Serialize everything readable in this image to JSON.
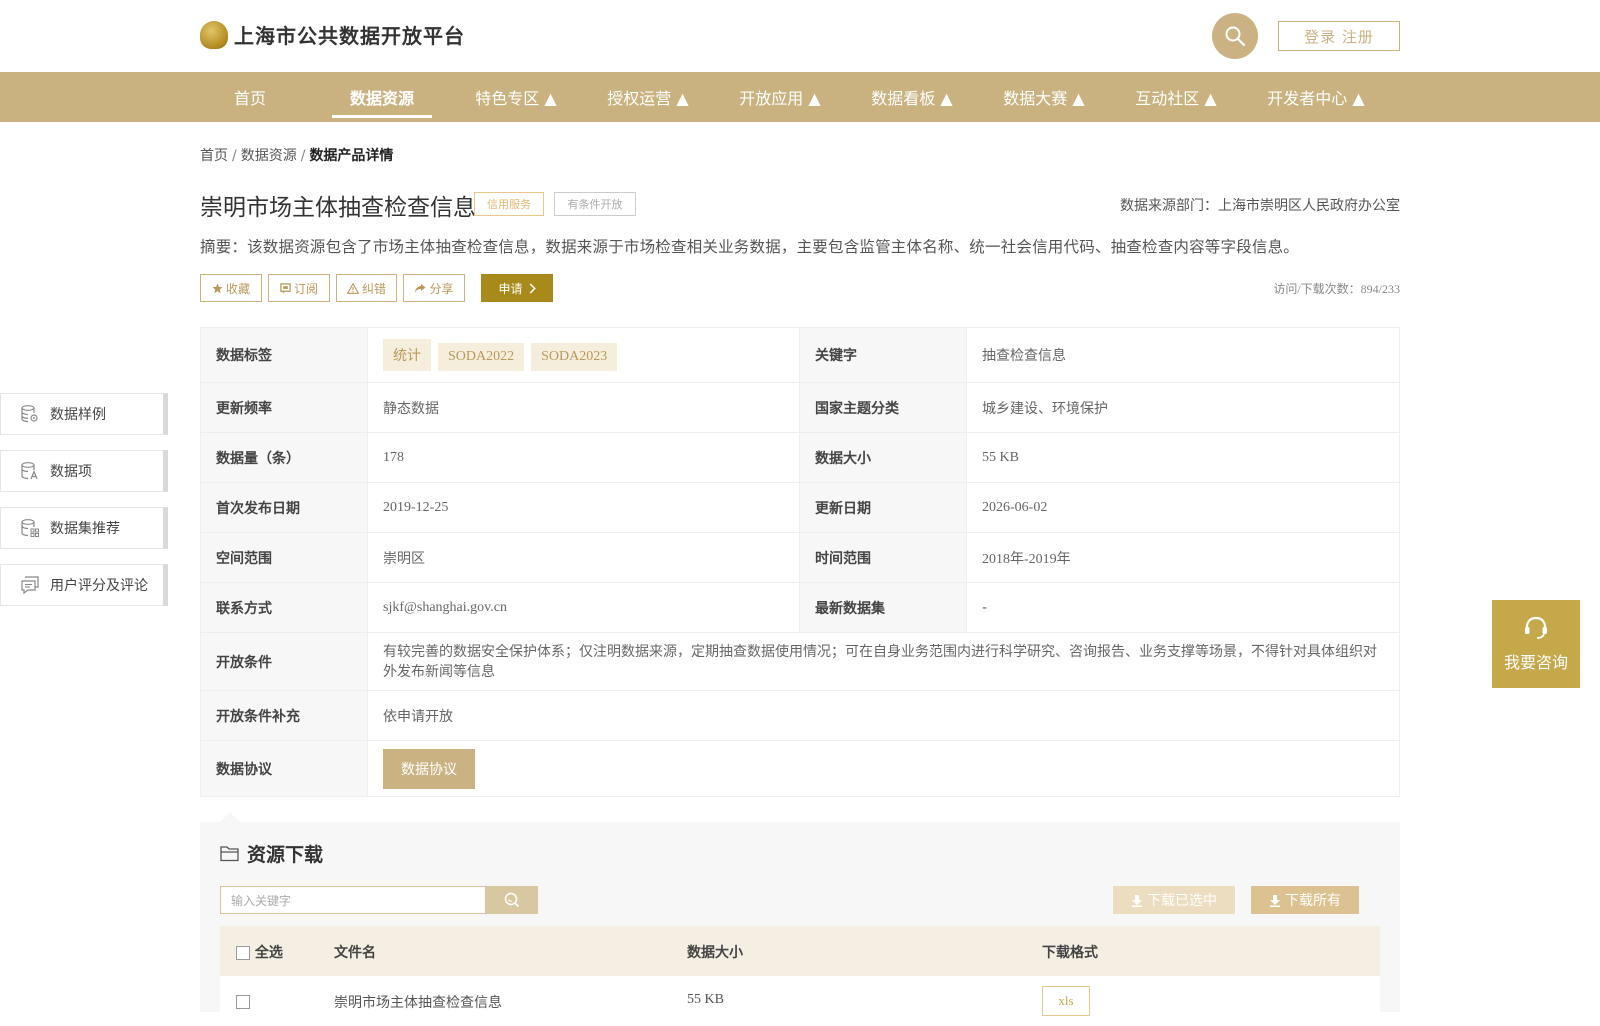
{
  "header": {
    "site_title": "上海市公共数据开放平台",
    "login_label": "登录 注册"
  },
  "nav": {
    "items": [
      {
        "label": "首页"
      },
      {
        "label": "数据资源",
        "active": true
      },
      {
        "label": "特色专区 ▲"
      },
      {
        "label": "授权运营 ▲"
      },
      {
        "label": "开放应用 ▲"
      },
      {
        "label": "数据看板 ▲"
      },
      {
        "label": "数据大赛 ▲"
      },
      {
        "label": "互动社区 ▲"
      },
      {
        "label": "开发者中心 ▲"
      }
    ]
  },
  "breadcrumb": {
    "home": "首页",
    "sep": "/",
    "section": "数据资源",
    "current": "数据产品详情"
  },
  "dataset": {
    "title": "崇明市场主体抽查检查信息",
    "tag_service": "信用服务",
    "tag_condition": "有条件开放",
    "source_dept": "数据来源部门：上海市崇明区人民政府办公室",
    "summary": "摘要：该数据资源包含了市场主体抽查检查信息，数据来源于市场检查相关业务数据，主要包含监管主体名称、统一社会信用代码、抽查检查内容等字段信息。",
    "visits": "访问/下载次数：894/233"
  },
  "actions": {
    "favorite": "收藏",
    "subscribe": "订阅",
    "correct": "纠错",
    "share": "分享",
    "apply": "申请"
  },
  "info": {
    "tags_label": "数据标签",
    "tags": [
      "统计",
      "SODA2022",
      "SODA2023"
    ],
    "keyword_label": "关键字",
    "keyword": "抽查检查信息",
    "freq_label": "更新频率",
    "freq": "静态数据",
    "theme_label": "国家主题分类",
    "theme": "城乡建设、环境保护",
    "count_label": "数据量（条）",
    "count": "178",
    "size_label": "数据大小",
    "size": "55 KB",
    "first_label": "首次发布日期",
    "first": "2019-12-25",
    "update_label": "更新日期",
    "update": "2026-06-02",
    "space_label": "空间范围",
    "space": "崇明区",
    "time_label": "时间范围",
    "time": "2018年-2019年",
    "contact_label": "联系方式",
    "contact": "sjkf@shanghai.gov.cn",
    "latest_label": "最新数据集",
    "latest": "-",
    "open_label": "开放条件",
    "open": "有较完善的数据安全保护体系；仅注明数据来源，定期抽查数据使用情况；可在自身业务范围内进行科学研究、咨询报告、业务支撑等场景，不得针对具体组织对外发布新闻等信息",
    "open_extra_label": "开放条件补充",
    "open_extra": "依申请开放",
    "protocol_label": "数据协议",
    "protocol_btn": "数据协议"
  },
  "side_tabs": [
    {
      "label": "数据样例",
      "icon": "database-gear-icon"
    },
    {
      "label": "数据项",
      "icon": "database-text-icon"
    },
    {
      "label": "数据集推荐",
      "icon": "database-grid-icon"
    },
    {
      "label": "用户评分及评论",
      "icon": "comment-icon"
    }
  ],
  "consult": {
    "label": "我要咨询",
    "icon": "headset-icon"
  },
  "download": {
    "title": "资源下载",
    "search_placeholder": "输入关键字",
    "download_selected": "下载已选中",
    "download_all": "下载所有",
    "col_select_all": "全选",
    "col_filename": "文件名",
    "col_size": "数据大小",
    "col_format": "下载格式",
    "rows": [
      {
        "filename": "崇明市场主体抽查检查信息",
        "size": "55 KB",
        "format": "xls"
      }
    ]
  },
  "colors": {
    "brand": "#c9b27f",
    "apply": "#a88a1a",
    "consult": "#c4a84a"
  }
}
